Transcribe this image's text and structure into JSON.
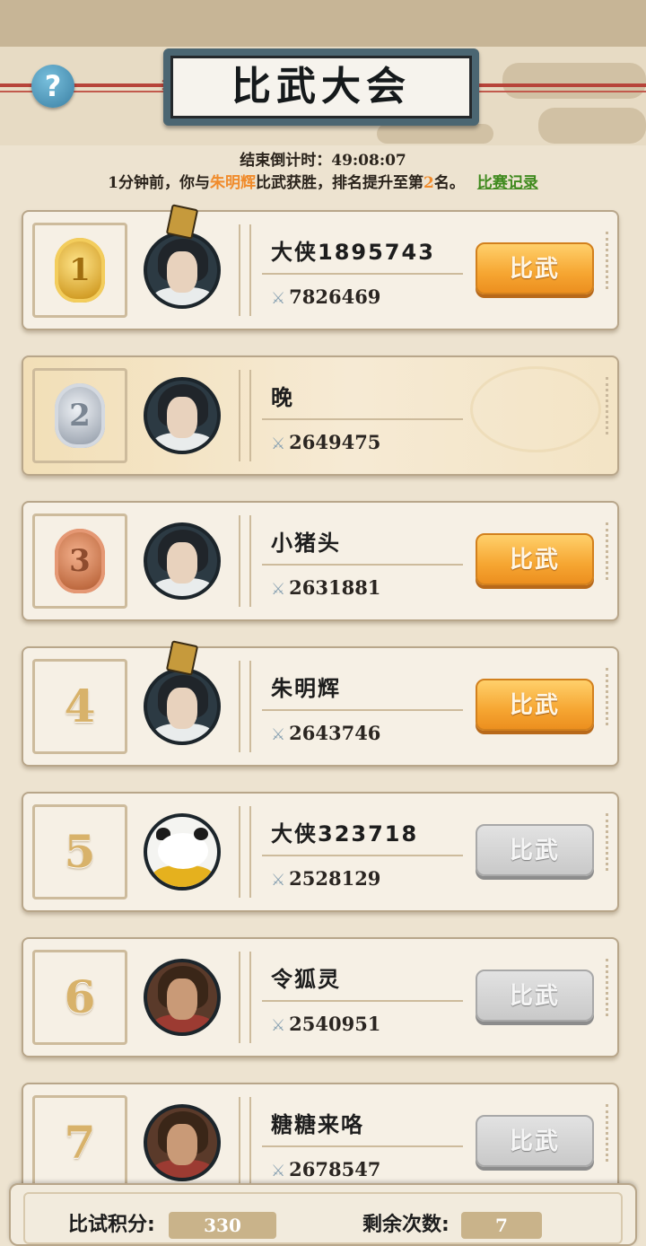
{
  "header": {
    "title": "比武大会",
    "help_label": "?",
    "countdown": "结束倒计时：49:08:07"
  },
  "notice": {
    "prefix": "1分钟前，你与",
    "opponent": "朱明辉",
    "middle": "比武获胜，排名提升至第",
    "rank": "2",
    "suffix": "名。",
    "record_link": "比赛记录"
  },
  "ranking": [
    {
      "rank": "1",
      "name": "大侠1895743",
      "power": "7826469",
      "button": "比武",
      "button_state": "active",
      "medal": "gold",
      "is_self": false
    },
    {
      "rank": "2",
      "name": "晚",
      "power": "2649475",
      "button": "",
      "button_state": "none",
      "medal": "silver",
      "is_self": true
    },
    {
      "rank": "3",
      "name": "小猪头",
      "power": "2631881",
      "button": "比武",
      "button_state": "active",
      "medal": "bronze",
      "is_self": false
    },
    {
      "rank": "4",
      "name": "朱明辉",
      "power": "2643746",
      "button": "比武",
      "button_state": "active",
      "medal": "none",
      "is_self": false
    },
    {
      "rank": "5",
      "name": "大侠323718",
      "power": "2528129",
      "button": "比武",
      "button_state": "disabled",
      "medal": "none",
      "is_self": false
    },
    {
      "rank": "6",
      "name": "令狐灵",
      "power": "2540951",
      "button": "比武",
      "button_state": "disabled",
      "medal": "none",
      "is_self": false
    },
    {
      "rank": "7",
      "name": "糖糖来咯",
      "power": "2678547",
      "button": "比武",
      "button_state": "disabled",
      "medal": "none",
      "is_self": false
    }
  ],
  "footer": {
    "score_label": "比试积分:",
    "score_value": "330",
    "remaining_label": "剩余次数:",
    "remaining_value": "7"
  },
  "colors": {
    "accent_orange": "#f6a632",
    "link_green": "#3f8a1e",
    "highlight_name": "#f08b2b",
    "disabled_gray": "#c9c9c9"
  },
  "icons": {
    "power": "crossed-swords-icon",
    "help": "question-mark-icon"
  }
}
